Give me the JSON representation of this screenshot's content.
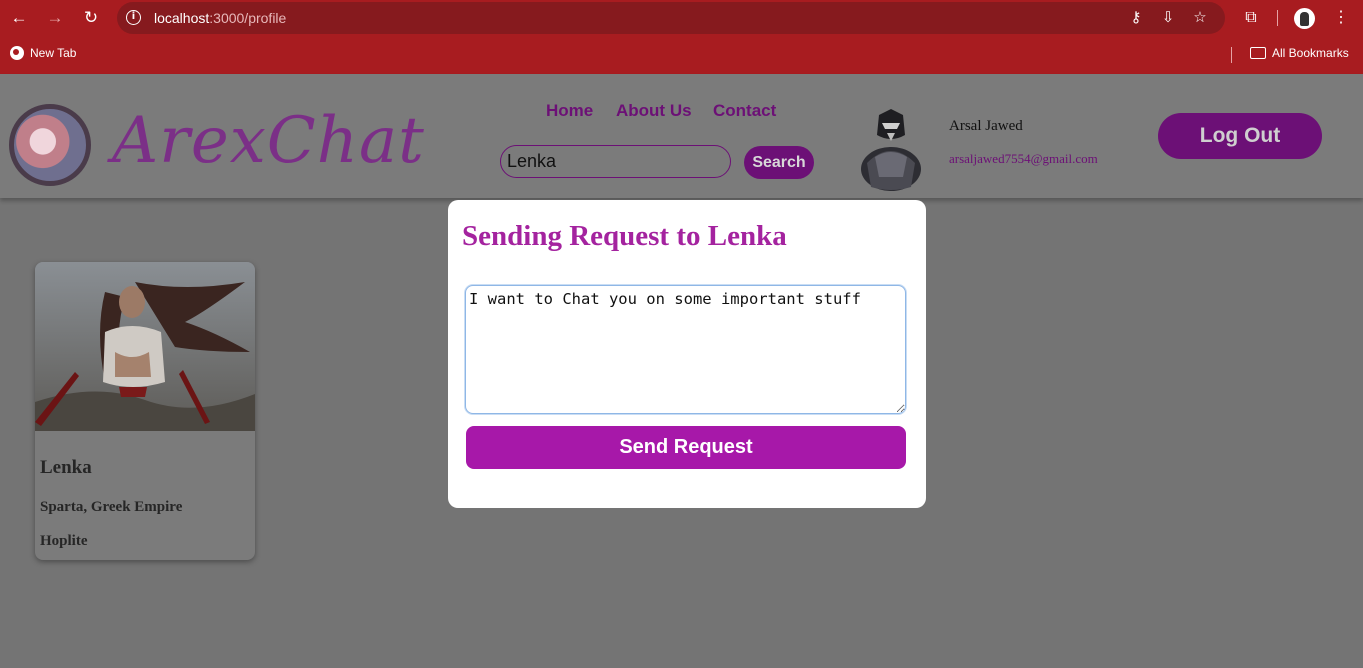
{
  "browser": {
    "url_host": "localhost",
    "url_path": ":3000/profile",
    "bookmarks": {
      "new_tab_label": "New Tab",
      "all_bookmarks_label": "All Bookmarks"
    },
    "icons": [
      "back-icon",
      "forward-icon",
      "reload-icon",
      "info-icon",
      "key-icon",
      "install-icon",
      "star-icon",
      "extensions-icon",
      "profile-avatar-icon",
      "menu-icon"
    ]
  },
  "header": {
    "logo_text": "ArexChat",
    "nav": {
      "home": "Home",
      "about": "About Us",
      "contact": "Contact"
    },
    "search": {
      "value": "Lenka",
      "button_label": "Search"
    },
    "user": {
      "name": "Arsal Jawed",
      "email": "arsaljawed7554@gmail.com"
    },
    "logout_label": "Log Out"
  },
  "profile_card": {
    "name": "Lenka",
    "location": "Sparta, Greek Empire",
    "role": "Hoplite"
  },
  "modal": {
    "title": "Sending Request to Lenka",
    "message_value": "I want to Chat you on some important stuff",
    "send_label": "Send Request"
  },
  "colors": {
    "chrome_red": "#a81c20",
    "brand_purple": "#6c1076",
    "accent_magenta": "#a718a9",
    "overlay_gray": "#747474"
  }
}
